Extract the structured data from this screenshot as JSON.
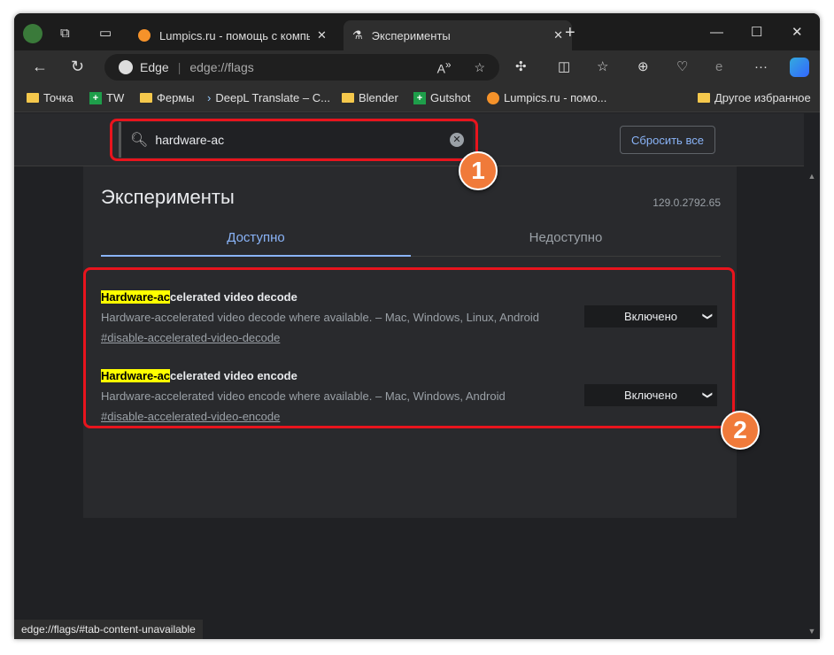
{
  "tabs": [
    {
      "label": "Lumpics.ru - помощь с компьюте",
      "icon": "orange-favicon"
    },
    {
      "label": "Эксперименты",
      "icon": "flask-icon",
      "active": true
    }
  ],
  "address": {
    "brand": "Edge",
    "url": "edge://flags"
  },
  "bookmarks": [
    {
      "label": "Точка",
      "icon": "folder"
    },
    {
      "label": "TW",
      "icon": "green"
    },
    {
      "label": "Фермы",
      "icon": "folder"
    },
    {
      "label": "DeepL Translate – C...",
      "icon": "deepl"
    },
    {
      "label": "Blender",
      "icon": "folder"
    },
    {
      "label": "Gutshot",
      "icon": "green"
    },
    {
      "label": "Lumpics.ru - помо...",
      "icon": "orange"
    }
  ],
  "other_favorites": "Другое избранное",
  "search": {
    "value": "hardware-ac"
  },
  "reset_label": "Сбросить все",
  "title": "Эксперименты",
  "version": "129.0.2792.65",
  "tab_available": "Доступно",
  "tab_unavailable": "Недоступно",
  "flags": [
    {
      "highlight": "Hardware-ac",
      "title_rest": "celerated video decode",
      "desc": "Hardware-accelerated video decode where available. – Mac, Windows, Linux, Android",
      "link": "#disable-accelerated-video-decode",
      "value": "Включено"
    },
    {
      "highlight": "Hardware-ac",
      "title_rest": "celerated video encode",
      "desc": "Hardware-accelerated video encode where available. – Mac, Windows, Android",
      "link": "#disable-accelerated-video-encode",
      "value": "Включено"
    }
  ],
  "badges": [
    "1",
    "2"
  ],
  "status_url": "edge://flags/#tab-content-unavailable",
  "colors": {
    "accent": "#8ab4f8",
    "highlight": "#ffff00",
    "annotation": "#e8141d"
  }
}
